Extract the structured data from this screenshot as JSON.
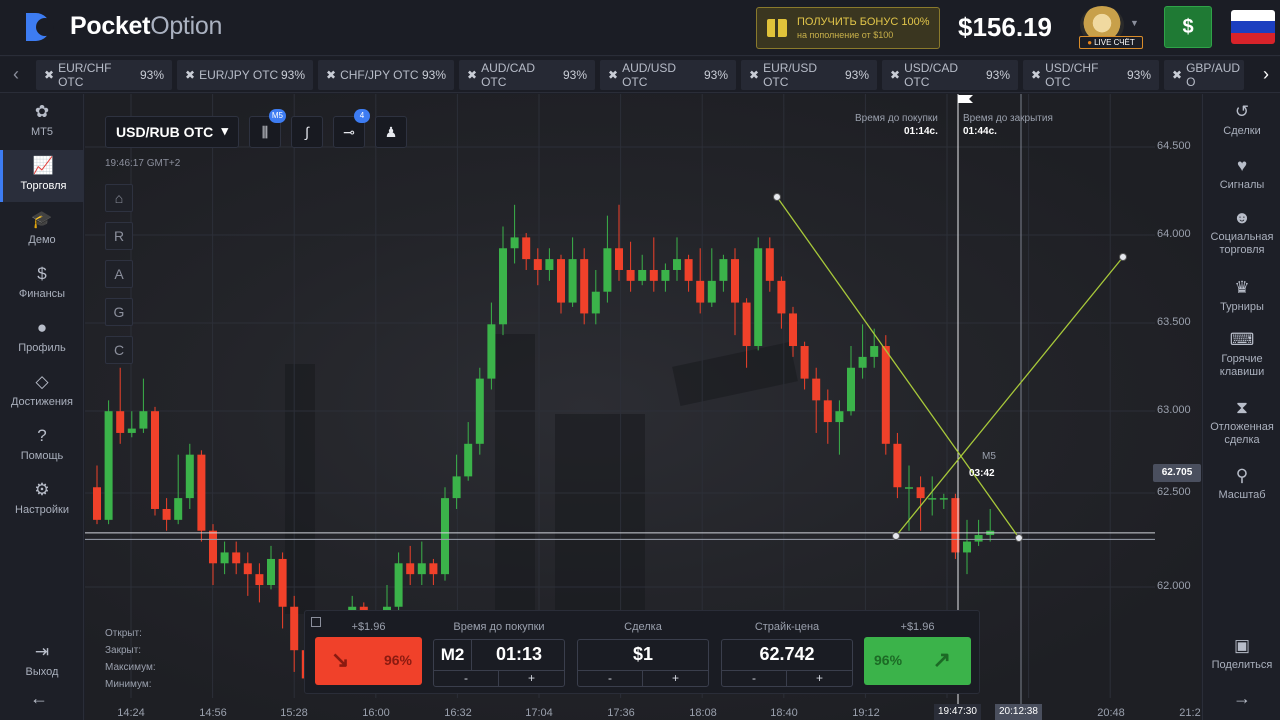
{
  "topbar": {
    "logo_bold": "Pocket",
    "logo_light": "Option",
    "bonus_line1": "ПОЛУЧИТЬ БОНУС 100%",
    "bonus_line2": "на пополнение от $100",
    "balance": "$156.19",
    "account_badge": "LIVE СЧЁТ",
    "deposit_label": "$",
    "flag_colors": [
      "#ffffff",
      "#1c3fc0",
      "#d8232a"
    ]
  },
  "asset_tabs": [
    {
      "name": "EUR/CHF OTC",
      "pct": "93%"
    },
    {
      "name": "EUR/JPY OTC",
      "pct": "93%"
    },
    {
      "name": "CHF/JPY OTC",
      "pct": "93%"
    },
    {
      "name": "AUD/CAD OTC",
      "pct": "93%"
    },
    {
      "name": "AUD/USD OTC",
      "pct": "93%"
    },
    {
      "name": "EUR/USD OTC",
      "pct": "93%"
    },
    {
      "name": "USD/CAD OTC",
      "pct": "93%"
    },
    {
      "name": "USD/CHF OTC",
      "pct": "93%"
    },
    {
      "name": "GBP/AUD O",
      "pct": ""
    }
  ],
  "leftnav": [
    {
      "label": "MT5",
      "icon": "mt5-icon"
    },
    {
      "label": "Торговля",
      "icon": "chart-icon"
    },
    {
      "label": "Демо",
      "icon": "graduation-cap-icon"
    },
    {
      "label": "Финансы",
      "icon": "dollar-icon"
    },
    {
      "label": "Профиль",
      "icon": "user-icon"
    },
    {
      "label": "Достижения",
      "icon": "diamond-icon"
    },
    {
      "label": "Помощь",
      "icon": "help-icon"
    },
    {
      "label": "Настройки",
      "icon": "gear-icon"
    },
    {
      "label": "Выход",
      "icon": "logout-icon"
    }
  ],
  "rightnav": [
    {
      "label": "Сделки",
      "icon": "history-icon"
    },
    {
      "label": "Сигналы",
      "icon": "heart-pulse-icon"
    },
    {
      "label": "Социальная торговля",
      "icon": "users-icon"
    },
    {
      "label": "Турниры",
      "icon": "trophy-icon"
    },
    {
      "label": "Горячие клавиши",
      "icon": "keyboard-icon"
    },
    {
      "label": "Отложенная сделка",
      "icon": "hourglass-icon"
    },
    {
      "label": "Масштаб",
      "icon": "zoom-icon"
    },
    {
      "label": "Поделиться",
      "icon": "image-icon"
    }
  ],
  "chart": {
    "asset": "USD/RUB OTC",
    "timeframe_badge": "M5",
    "indicator_badge": "4",
    "clock": "19:46:17 GMT+2",
    "side_tools": [
      "R",
      "A",
      "G",
      "C"
    ],
    "ohlc_labels": [
      "Открыт:",
      "Закрыт:",
      "Максимум:",
      "Минимум:"
    ],
    "buy_time_label": "Время до покупки",
    "buy_time_value": "01:14с.",
    "close_time_label": "Время до закрытия",
    "close_time_value": "01:44с.",
    "candle_timer_tf": "M5",
    "candle_timer_value": "03:42",
    "current_price": "62.705",
    "y_ticks": [
      "64.500",
      "64.000",
      "63.500",
      "63.000",
      "62.500",
      "62.000"
    ],
    "x_ticks": [
      "14:24",
      "14:56",
      "15:28",
      "16:00",
      "16:32",
      "17:04",
      "17:36",
      "18:08",
      "18:40",
      "19:12",
      "19:47:30",
      "20:12:38",
      "20:48",
      "21:2"
    ]
  },
  "chart_data": {
    "type": "candlestick",
    "ylim": [
      61.98,
      64.76
    ],
    "up_color": "#3bb34a",
    "down_color": "#f0412a",
    "candles": [
      [
        62.95,
        62.8,
        63.05,
        62.78
      ],
      [
        62.8,
        63.3,
        63.35,
        62.78
      ],
      [
        63.3,
        63.2,
        63.5,
        63.15
      ],
      [
        63.2,
        63.22,
        63.3,
        63.18
      ],
      [
        63.22,
        63.3,
        63.45,
        63.2
      ],
      [
        63.3,
        62.85,
        63.32,
        62.82
      ],
      [
        62.85,
        62.8,
        62.9,
        62.75
      ],
      [
        62.8,
        62.9,
        63.1,
        62.78
      ],
      [
        62.9,
        63.1,
        63.15,
        62.85
      ],
      [
        63.1,
        62.75,
        63.12,
        62.7
      ],
      [
        62.75,
        62.6,
        62.78,
        62.5
      ],
      [
        62.6,
        62.65,
        62.7,
        62.55
      ],
      [
        62.65,
        62.6,
        62.7,
        62.55
      ],
      [
        62.6,
        62.55,
        62.65,
        62.45
      ],
      [
        62.55,
        62.5,
        62.6,
        62.42
      ],
      [
        62.5,
        62.62,
        62.68,
        62.48
      ],
      [
        62.62,
        62.4,
        62.65,
        62.3
      ],
      [
        62.4,
        62.2,
        62.45,
        62.1
      ],
      [
        62.2,
        62.07,
        62.25,
        62.03
      ],
      [
        62.07,
        62.15,
        62.2,
        62.05
      ],
      [
        62.15,
        62.25,
        62.28,
        62.1
      ],
      [
        62.25,
        62.28,
        62.35,
        62.2
      ],
      [
        62.28,
        62.4,
        62.45,
        62.25
      ],
      [
        62.4,
        62.3,
        62.42,
        62.25
      ],
      [
        62.3,
        62.2,
        62.32,
        62.15
      ],
      [
        62.2,
        62.4,
        62.5,
        62.18
      ],
      [
        62.4,
        62.6,
        62.65,
        62.35
      ],
      [
        62.6,
        62.55,
        62.68,
        62.5
      ],
      [
        62.55,
        62.6,
        62.7,
        62.5
      ],
      [
        62.6,
        62.55,
        62.62,
        62.5
      ],
      [
        62.55,
        62.9,
        62.95,
        62.52
      ],
      [
        62.9,
        63.0,
        63.1,
        62.85
      ],
      [
        63.0,
        63.15,
        63.25,
        62.98
      ],
      [
        63.15,
        63.45,
        63.5,
        63.1
      ],
      [
        63.45,
        63.7,
        63.8,
        63.4
      ],
      [
        63.7,
        64.05,
        64.15,
        63.65
      ],
      [
        64.05,
        64.1,
        64.25,
        63.98
      ],
      [
        64.1,
        64.0,
        64.12,
        63.95
      ],
      [
        64.0,
        63.95,
        64.05,
        63.88
      ],
      [
        63.95,
        64.0,
        64.05,
        63.9
      ],
      [
        64.0,
        63.8,
        64.02,
        63.75
      ],
      [
        63.8,
        64.0,
        64.1,
        63.78
      ],
      [
        64.0,
        63.75,
        64.05,
        63.7
      ],
      [
        63.75,
        63.85,
        63.95,
        63.7
      ],
      [
        63.85,
        64.05,
        64.2,
        63.8
      ],
      [
        64.05,
        63.95,
        64.25,
        63.9
      ],
      [
        63.95,
        63.9,
        64.08,
        63.85
      ],
      [
        63.9,
        63.95,
        64.02,
        63.88
      ],
      [
        63.95,
        63.9,
        64.1,
        63.85
      ],
      [
        63.9,
        63.95,
        63.98,
        63.85
      ],
      [
        63.95,
        64.0,
        64.1,
        63.9
      ],
      [
        64.0,
        63.9,
        64.02,
        63.85
      ],
      [
        63.9,
        63.8,
        64.05,
        63.75
      ],
      [
        63.8,
        63.9,
        64.05,
        63.78
      ],
      [
        63.9,
        64.0,
        64.02,
        63.85
      ],
      [
        64.0,
        63.8,
        64.05,
        63.65
      ],
      [
        63.8,
        63.6,
        63.82,
        63.5
      ],
      [
        63.6,
        64.05,
        64.1,
        63.58
      ],
      [
        64.05,
        63.9,
        64.1,
        63.85
      ],
      [
        63.9,
        63.75,
        63.92,
        63.68
      ],
      [
        63.75,
        63.6,
        63.78,
        63.55
      ],
      [
        63.6,
        63.45,
        63.62,
        63.4
      ],
      [
        63.45,
        63.35,
        63.5,
        63.2
      ],
      [
        63.35,
        63.25,
        63.4,
        63.15
      ],
      [
        63.25,
        63.3,
        63.35,
        63.1
      ],
      [
        63.3,
        63.5,
        63.6,
        63.28
      ],
      [
        63.5,
        63.55,
        63.7,
        63.45
      ],
      [
        63.55,
        63.6,
        63.68,
        63.5
      ],
      [
        63.6,
        63.15,
        63.65,
        63.1
      ],
      [
        63.15,
        62.95,
        63.2,
        62.9
      ],
      [
        62.95,
        62.95,
        63.05,
        62.75
      ],
      [
        62.95,
        62.9,
        63.0,
        62.75
      ],
      [
        62.9,
        62.9,
        63.0,
        62.82
      ],
      [
        62.9,
        62.9,
        62.92,
        62.85
      ],
      [
        62.9,
        62.65,
        62.92,
        62.62
      ],
      [
        62.65,
        62.7,
        62.8,
        62.55
      ],
      [
        62.7,
        62.73,
        62.8,
        62.68
      ],
      [
        62.73,
        62.75,
        62.85,
        62.7
      ]
    ],
    "drawings": [
      {
        "from": [
          "17:45",
          64.32
        ],
        "to": [
          "20:12:38",
          62.28
        ]
      },
      {
        "from": [
          "19:18",
          62.29
        ],
        "to": [
          "21:00",
          63.87
        ]
      }
    ]
  },
  "trade": {
    "down_profit": "+$1.96",
    "down_pct": "96%",
    "time_label": "Время до покупки",
    "time_mode": "M2",
    "time_value": "01:13",
    "amount_label": "Сделка",
    "amount_value": "$1",
    "strike_label": "Страйк-цена",
    "strike_value": "62.742",
    "up_profit": "+$1.96",
    "up_pct": "96%",
    "minus": "-",
    "plus": "+"
  }
}
